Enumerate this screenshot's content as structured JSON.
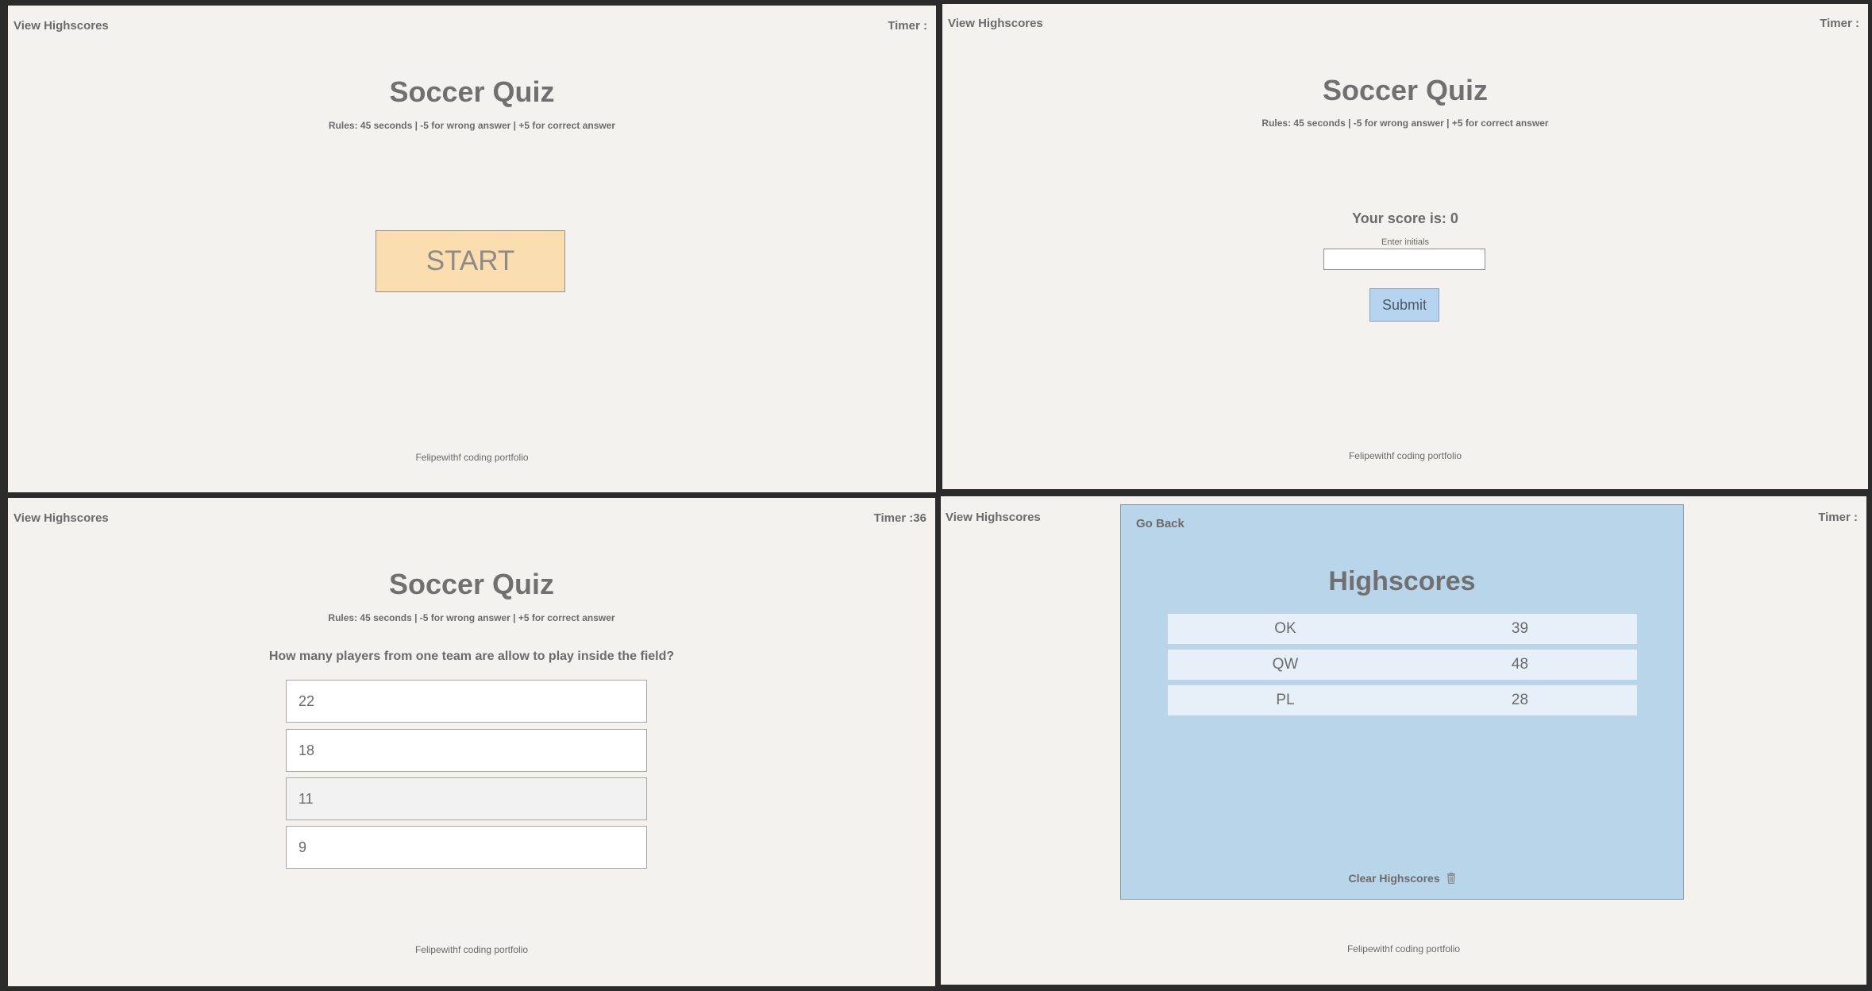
{
  "common": {
    "view_highscores": "View Highscores",
    "quiz_title": "Soccer Quiz",
    "rules": "Rules: 45 seconds | -5 for wrong answer | +5 for correct answer",
    "footer": "Felipewithf coding portfolio"
  },
  "start_screen": {
    "timer": "Timer :",
    "start_label": "START"
  },
  "score_screen": {
    "timer": "Timer :",
    "score_text": "Your score is: 0",
    "initials_label": "Enter initials",
    "initials_value": "",
    "submit_label": "Submit"
  },
  "question_screen": {
    "timer": "Timer :36",
    "question": "How many players from one team are allow to play inside the field?",
    "answers": [
      "22",
      "18",
      "11",
      "9"
    ]
  },
  "highscores_screen": {
    "timer": "Timer :",
    "go_back": "Go Back",
    "title": "Highscores",
    "rows": [
      {
        "initials": "OK",
        "score": "39"
      },
      {
        "initials": "QW",
        "score": "48"
      },
      {
        "initials": "PL",
        "score": "28"
      }
    ],
    "clear_label": "Clear Highscores",
    "clear_icon": "trash-icon"
  }
}
